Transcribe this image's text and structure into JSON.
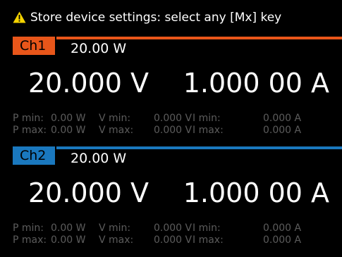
{
  "status": {
    "icon": "warning-triangle-icon",
    "message": "Store device settings: select any [Mx] key"
  },
  "channels": [
    {
      "tab": "Ch1",
      "color": "#e8561a",
      "power_limit": "20.00 W",
      "voltage": "20.000 V",
      "current": "1.000 00 A",
      "stats": {
        "p_min_label": "P min:",
        "p_min": "0.00 W",
        "v_min_label": "V min:",
        "v_min": "0.000 V",
        "i_min_label": "I min:",
        "i_min": "0.000 A",
        "p_max_label": "P max:",
        "p_max": "0.00 W",
        "v_max_label": "V max:",
        "v_max": "0.000 V",
        "i_max_label": "I max:",
        "i_max": "0.000 A"
      }
    },
    {
      "tab": "Ch2",
      "color": "#1a78be",
      "power_limit": "20.00 W",
      "voltage": "20.000 V",
      "current": "1.000 00 A",
      "stats": {
        "p_min_label": "P min:",
        "p_min": "0.00 W",
        "v_min_label": "V min:",
        "v_min": "0.000 V",
        "i_min_label": "I min:",
        "i_min": "0.000 A",
        "p_max_label": "P max:",
        "p_max": "0.00 W",
        "v_max_label": "V max:",
        "v_max": "0.000 V",
        "i_max_label": "I max:",
        "i_max": "0.000 A"
      }
    }
  ]
}
